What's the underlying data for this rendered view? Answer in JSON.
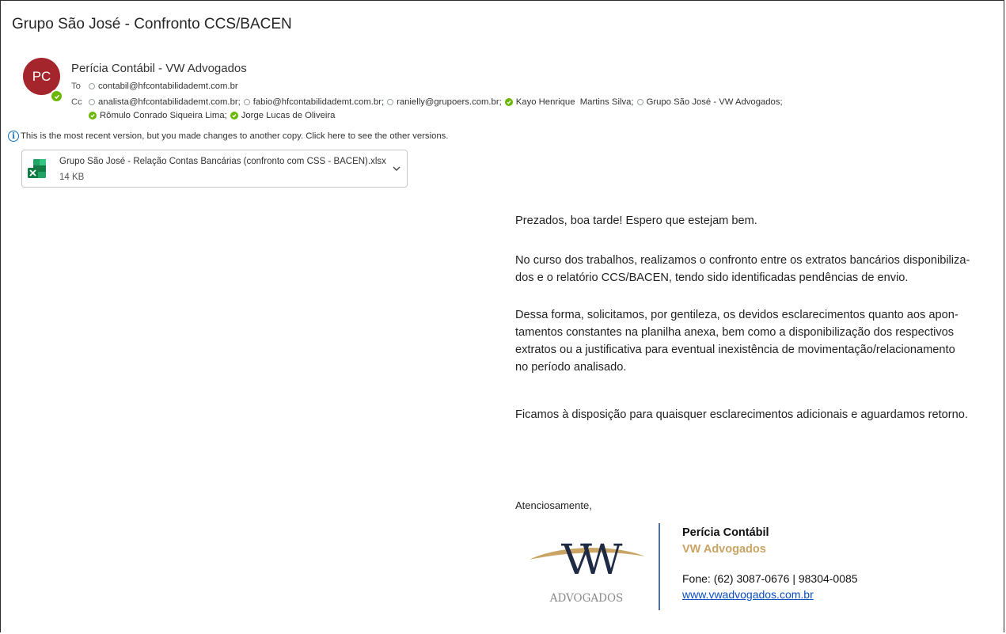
{
  "email": {
    "subject": "Grupo São José - Confronto CCS/BACEN",
    "sender": {
      "initials": "PC",
      "name": "Perícia Contábil - VW Advogados"
    },
    "to_label": "To",
    "to": [
      {
        "name": "contabil@hfcontabilidademt.com.br",
        "status": "unknown"
      }
    ],
    "cc_label": "Cc",
    "cc_line1": [
      {
        "name": "analista@hfcontabilidademt.com.br;",
        "status": "unknown"
      },
      {
        "name": "fabio@hfcontabilidademt.com.br;",
        "status": "unknown"
      },
      {
        "name": "ranielly@grupoers.com.br;",
        "status": "unknown"
      },
      {
        "name": "Kayo Henrique  Martins Silva;",
        "status": "available"
      },
      {
        "name": "Grupo São José - VW Advogados;",
        "status": "unknown"
      }
    ],
    "cc_line2": [
      {
        "name": "Rômulo Conrado Siqueira Lima;",
        "status": "available"
      },
      {
        "name": "Jorge Lucas de Oliveira",
        "status": "available"
      }
    ],
    "info_banner": "This is the most recent version, but you made changes to another copy. Click here to see the other versions.",
    "attachment": {
      "filename": "Grupo São José - Relação Contas Bancárias (confronto com CSS - BACEN).xlsx",
      "size": "14 KB"
    },
    "body": {
      "p1": [
        "Prezados, boa tarde! Espero que estejam bem."
      ],
      "p2": [
        "No curso dos trabalhos, realizamos o confronto entre os extratos bancários disponibiliza-",
        "dos e o relatório CCS/BACEN, tendo sido identificadas pendências de envio."
      ],
      "p3": [
        "Dessa forma, solicitamos, por gentileza, os devidos esclarecimentos quanto aos apon-",
        "tamentos constantes na planilha anexa, bem como a disponibilização dos respectivos",
        "extratos ou a justificativa para eventual inexistência de movimentação/relacionamento",
        "no período analisado."
      ],
      "p4": [
        "Ficamos à disposição para quaisquer esclarecimentos adicionais e aguardamos retorno."
      ]
    },
    "closing": "Atenciosamente,",
    "signature": {
      "logo_monogram": "VW",
      "logo_word": "ADVOGADOS",
      "name": "Perícia Contábil",
      "firm": "VW Advogados",
      "phone": "Fone: (62) 3087-0676 | 98304-0085",
      "website": "www.vwadvogados.com.br"
    }
  },
  "colors": {
    "avatar_bg": "#a4262c",
    "presence_available": "#6bb700",
    "info_blue": "#0f6cbd",
    "signature_gold": "#c9a464",
    "signature_divider": "#4a6fa1",
    "link_blue": "#0b4fbf",
    "excel_green": "#107c41"
  }
}
